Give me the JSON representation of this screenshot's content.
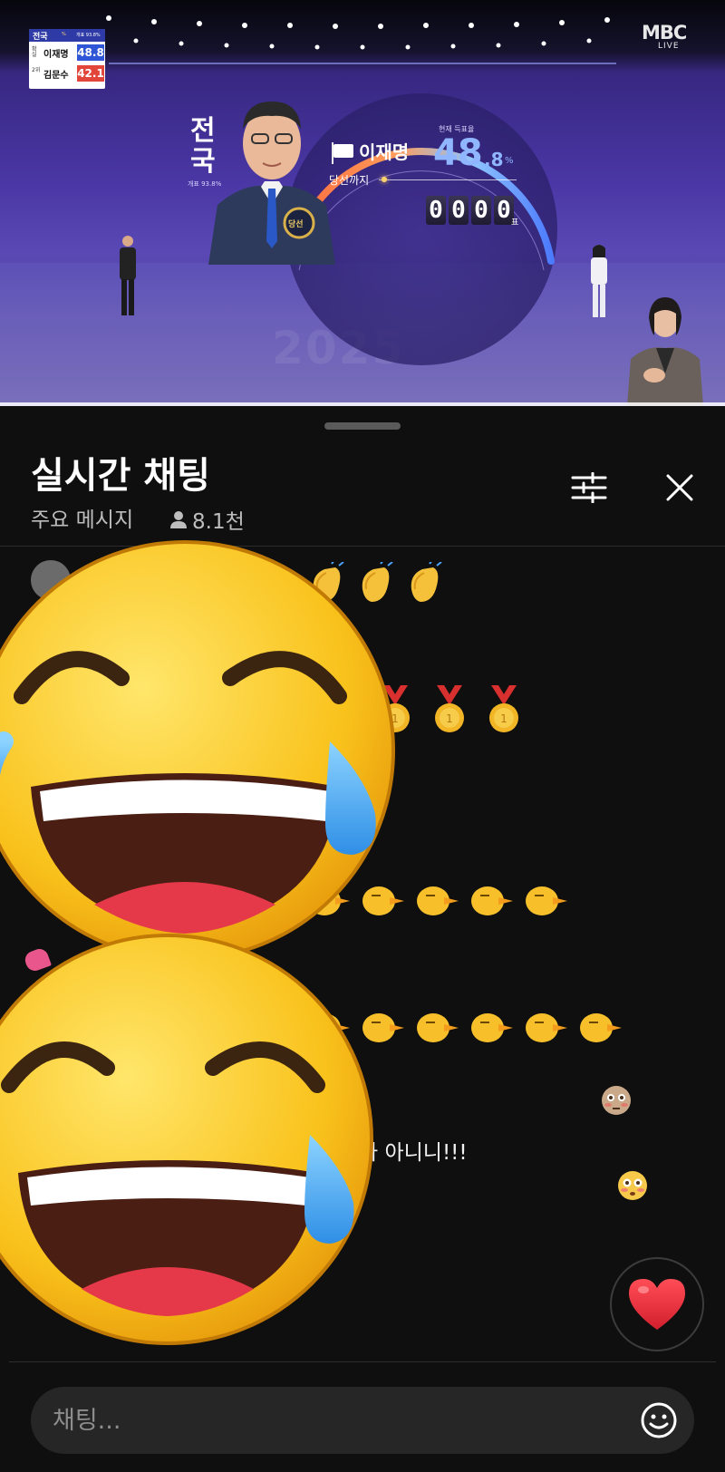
{
  "broadcast": {
    "region_label": "전국",
    "region_sub": "개표 93.8%",
    "candidate_name": "이재명",
    "rate_caption": "현재 득표율",
    "rate_whole": "48",
    "rate_decimal": ".8",
    "rate_unit": "%",
    "until_win_label": "당선까지",
    "counter_digits": [
      "0",
      "0",
      "0",
      "0"
    ],
    "counter_unit": "표",
    "badge_text": "당선",
    "watermark_year": "2025",
    "channel_logo": "MBC",
    "channel_live": "LIVE",
    "scoreboard": {
      "title": "전국",
      "pct_label": "%",
      "count_label": "개표 93.8%",
      "rows": [
        {
          "rank": "확실",
          "name": "이재명",
          "value": "48.8",
          "color": "#2f56d6"
        },
        {
          "rank": "2위",
          "name": "김문수",
          "value": "42.1",
          "color": "#e2463a"
        }
      ]
    }
  },
  "chat": {
    "title": "실시간 채팅",
    "subtitle": "주요 메시지",
    "viewer_count": "8.1천",
    "message_text": "가 아니니!!!",
    "input_placeholder": "채팅..."
  },
  "icons": {
    "filter": "sliders-icon",
    "close": "close-icon",
    "viewer": "person-icon",
    "heart": "heart-icon",
    "emoji": "smiley-icon"
  },
  "colors": {
    "background": "#0f0f0f",
    "stage_purple": "#4a37a5",
    "rate_blue": "#8fb6ff",
    "heart_red": "#e5323e"
  }
}
